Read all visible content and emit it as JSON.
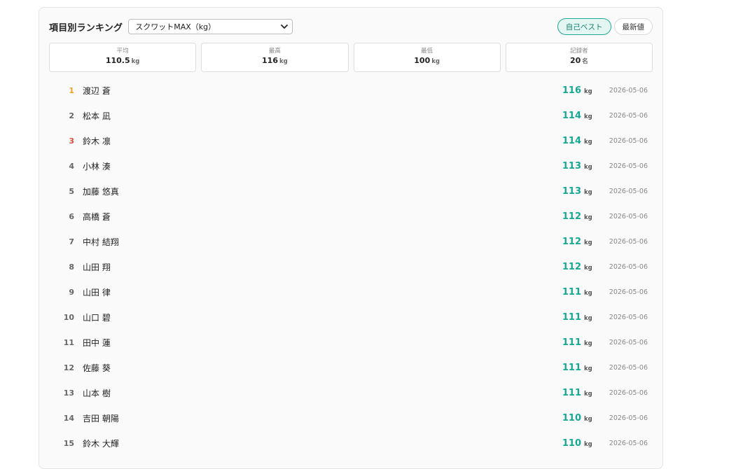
{
  "header": {
    "title": "項目別ランキング",
    "select_value": "スクワットMAX（kg）",
    "toggles": [
      {
        "label": "自己ベスト",
        "active": true
      },
      {
        "label": "最新値",
        "active": false
      }
    ]
  },
  "stats": [
    {
      "label": "平均",
      "value": "110.5",
      "unit": "kg"
    },
    {
      "label": "最高",
      "value": "116",
      "unit": "kg"
    },
    {
      "label": "最低",
      "value": "100",
      "unit": "kg"
    },
    {
      "label": "記録者",
      "value": "20",
      "unit": "名"
    }
  ],
  "rank_colors": {
    "1": "#f0a020",
    "3": "#e24a3b",
    "default": "#666666"
  },
  "rows": [
    {
      "rank": "1",
      "name": "渡辺 蒼",
      "score": "116",
      "unit": "kg",
      "date": "2026-05-06"
    },
    {
      "rank": "2",
      "name": "松本 凪",
      "score": "114",
      "unit": "kg",
      "date": "2026-05-06"
    },
    {
      "rank": "3",
      "name": "鈴木 凛",
      "score": "114",
      "unit": "kg",
      "date": "2026-05-06"
    },
    {
      "rank": "4",
      "name": "小林 湊",
      "score": "113",
      "unit": "kg",
      "date": "2026-05-06"
    },
    {
      "rank": "5",
      "name": "加藤 悠真",
      "score": "113",
      "unit": "kg",
      "date": "2026-05-06"
    },
    {
      "rank": "6",
      "name": "高橋 蒼",
      "score": "112",
      "unit": "kg",
      "date": "2026-05-06"
    },
    {
      "rank": "7",
      "name": "中村 結翔",
      "score": "112",
      "unit": "kg",
      "date": "2026-05-06"
    },
    {
      "rank": "8",
      "name": "山田 翔",
      "score": "112",
      "unit": "kg",
      "date": "2026-05-06"
    },
    {
      "rank": "9",
      "name": "山田 律",
      "score": "111",
      "unit": "kg",
      "date": "2026-05-06"
    },
    {
      "rank": "10",
      "name": "山口 碧",
      "score": "111",
      "unit": "kg",
      "date": "2026-05-06"
    },
    {
      "rank": "11",
      "name": "田中 蓮",
      "score": "111",
      "unit": "kg",
      "date": "2026-05-06"
    },
    {
      "rank": "12",
      "name": "佐藤 葵",
      "score": "111",
      "unit": "kg",
      "date": "2026-05-06"
    },
    {
      "rank": "13",
      "name": "山本 樹",
      "score": "111",
      "unit": "kg",
      "date": "2026-05-06"
    },
    {
      "rank": "14",
      "name": "吉田 朝陽",
      "score": "110",
      "unit": "kg",
      "date": "2026-05-06"
    },
    {
      "rank": "15",
      "name": "鈴木 大輝",
      "score": "110",
      "unit": "kg",
      "date": "2026-05-06"
    }
  ]
}
